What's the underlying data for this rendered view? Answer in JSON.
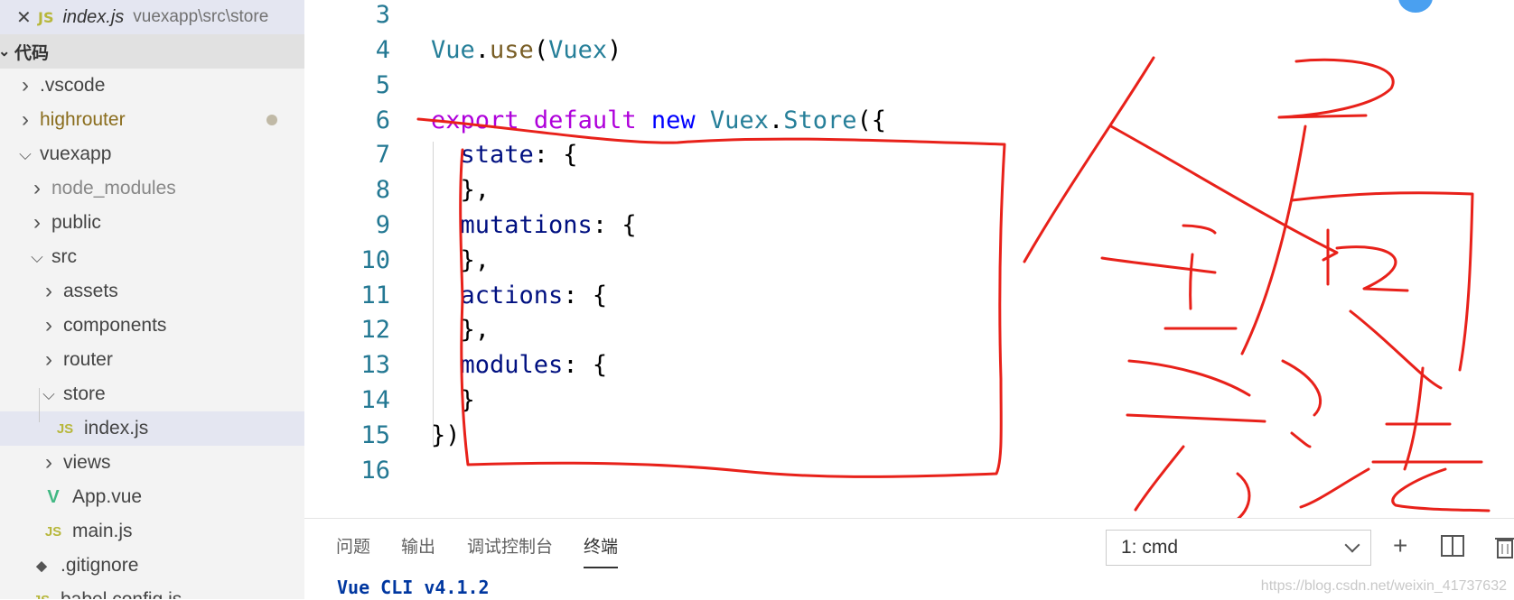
{
  "open_editor": {
    "close_glyph": "✕",
    "badge": "JS",
    "filename": "index.js",
    "path": "vuexapp\\src\\store"
  },
  "explorer": {
    "section_title": "代码",
    "items": [
      {
        "label": ".vscode",
        "kind": "folder",
        "state": "collapsed",
        "depth": 0
      },
      {
        "label": "highrouter",
        "kind": "folder",
        "state": "collapsed",
        "depth": 0,
        "modified": true
      },
      {
        "label": "vuexapp",
        "kind": "folder",
        "state": "expanded",
        "depth": 0
      },
      {
        "label": "node_modules",
        "kind": "folder",
        "state": "collapsed",
        "depth": 1
      },
      {
        "label": "public",
        "kind": "folder",
        "state": "collapsed",
        "depth": 1
      },
      {
        "label": "src",
        "kind": "folder",
        "state": "expanded",
        "depth": 1
      },
      {
        "label": "assets",
        "kind": "folder",
        "state": "collapsed",
        "depth": 2
      },
      {
        "label": "components",
        "kind": "folder",
        "state": "collapsed",
        "depth": 2
      },
      {
        "label": "router",
        "kind": "folder",
        "state": "collapsed",
        "depth": 2
      },
      {
        "label": "store",
        "kind": "folder",
        "state": "expanded",
        "depth": 2
      },
      {
        "label": "index.js",
        "kind": "js",
        "depth": 3,
        "selected": true,
        "badge": "JS"
      },
      {
        "label": "views",
        "kind": "folder",
        "state": "collapsed",
        "depth": 2
      },
      {
        "label": "App.vue",
        "kind": "vue",
        "depth": 2,
        "badge": "V"
      },
      {
        "label": "main.js",
        "kind": "js",
        "depth": 2,
        "badge": "JS"
      },
      {
        "label": ".gitignore",
        "kind": "git",
        "depth": 1,
        "badge": "◆"
      },
      {
        "label": "babel.config.js",
        "kind": "js",
        "depth": 1,
        "badge": "JS"
      }
    ]
  },
  "editor": {
    "lines": [
      {
        "n": "3",
        "tokens": []
      },
      {
        "n": "4",
        "tokens": [
          [
            "t",
            "Vue"
          ],
          [
            "p",
            "."
          ],
          [
            "f",
            "use"
          ],
          [
            "p",
            "("
          ],
          [
            "t",
            "Vuex"
          ],
          [
            "p",
            ")"
          ]
        ]
      },
      {
        "n": "5",
        "tokens": []
      },
      {
        "n": "6",
        "tokens": [
          [
            "k",
            "export"
          ],
          [
            "p",
            " "
          ],
          [
            "k",
            "default"
          ],
          [
            "p",
            " "
          ],
          [
            "b",
            "new"
          ],
          [
            "p",
            " "
          ],
          [
            "t",
            "Vuex"
          ],
          [
            "p",
            "."
          ],
          [
            "t",
            "Store"
          ],
          [
            "p",
            "({"
          ]
        ]
      },
      {
        "n": "7",
        "tokens": [
          [
            "p",
            "  "
          ],
          [
            "v",
            "state"
          ],
          [
            "p",
            ": {"
          ]
        ]
      },
      {
        "n": "8",
        "tokens": [
          [
            "p",
            "  },"
          ]
        ]
      },
      {
        "n": "9",
        "tokens": [
          [
            "p",
            "  "
          ],
          [
            "v",
            "mutations"
          ],
          [
            "p",
            ": {"
          ]
        ]
      },
      {
        "n": "10",
        "tokens": [
          [
            "p",
            "  },"
          ]
        ]
      },
      {
        "n": "11",
        "tokens": [
          [
            "p",
            "  "
          ],
          [
            "v",
            "actions"
          ],
          [
            "p",
            ": {"
          ]
        ]
      },
      {
        "n": "12",
        "tokens": [
          [
            "p",
            "  },"
          ]
        ]
      },
      {
        "n": "13",
        "tokens": [
          [
            "p",
            "  "
          ],
          [
            "v",
            "modules"
          ],
          [
            "p",
            ": {"
          ]
        ]
      },
      {
        "n": "14",
        "tokens": [
          [
            "p",
            "  }"
          ]
        ]
      },
      {
        "n": "15",
        "tokens": [
          [
            "p",
            "})"
          ]
        ]
      },
      {
        "n": "16",
        "tokens": []
      }
    ]
  },
  "panel": {
    "tabs": [
      "问题",
      "输出",
      "调试控制台",
      "终端"
    ],
    "active_tab": "终端",
    "terminal_select": "1: cmd",
    "terminal_output": "Vue CLI v4.1.2",
    "add_glyph": "+",
    "watermark": "https://blog.csdn.net/weixin_41737632"
  },
  "colors": {
    "ink": "#e8211a",
    "keyword": "#af00db",
    "type": "#267f99",
    "variable": "#001080",
    "function": "#795e26",
    "line_number": "#237893"
  }
}
